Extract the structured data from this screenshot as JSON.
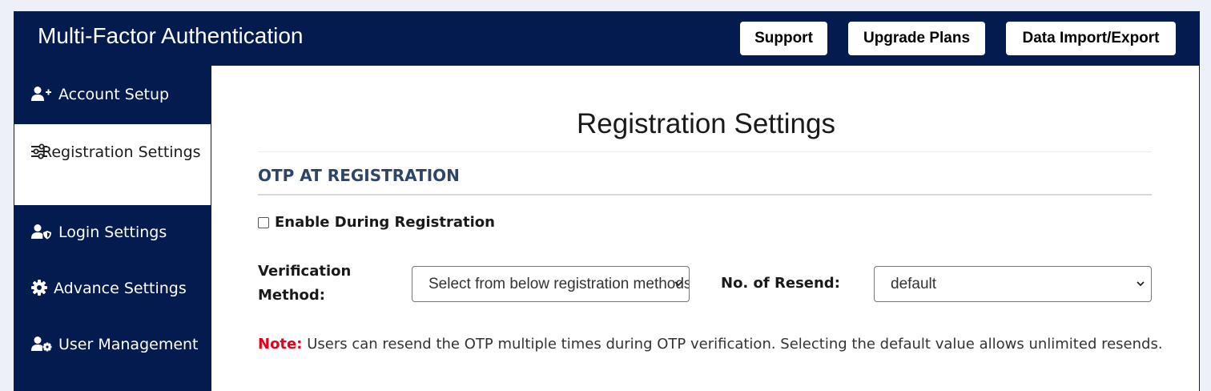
{
  "header": {
    "title": "Multi-Factor Authentication",
    "buttons": {
      "support": "Support",
      "upgrade": "Upgrade Plans",
      "import_export": "Data Import/Export"
    }
  },
  "sidebar": {
    "items": [
      {
        "label": "Account Setup",
        "icon": "user-plus-icon",
        "active": false
      },
      {
        "label": "Registration Settings",
        "icon": "sliders-icon",
        "active": true
      },
      {
        "label": "Login Settings",
        "icon": "user-shield-icon",
        "active": false
      },
      {
        "label": "Advance Settings",
        "icon": "gear-icon",
        "active": false
      },
      {
        "label": "User Management",
        "icon": "user-gear-icon",
        "active": false
      }
    ]
  },
  "main": {
    "title": "Registration Settings",
    "section_heading": "OTP AT REGISTRATION",
    "enable_label": "Enable During Registration",
    "enable_checked": false,
    "verification_label": "Verification Method:",
    "verification_value": "Select from below registration methods",
    "resend_label": "No. of Resend:",
    "resend_value": "default",
    "note_label": "Note:",
    "note_text": "Users can resend the OTP multiple times during OTP verification. Selecting the default value allows unlimited resends."
  },
  "colors": {
    "brand_navy": "#041b4f",
    "note_red": "#e3001b",
    "section_heading": "#2d4566"
  }
}
